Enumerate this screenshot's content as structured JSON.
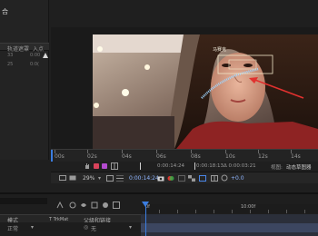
{
  "project_panel": {
    "title": "合",
    "columns": [
      "轨道遮罩",
      "入点"
    ],
    "rows": [
      {
        "a": "33",
        "b": "0:00"
      },
      {
        "a": "25",
        "b": "0:0("
      }
    ]
  },
  "viewer": {
    "mosaic_label": "马赛克",
    "colors": {
      "accent": "#e1312f",
      "track": "#9fd6ff"
    }
  },
  "time_ruler": {
    "labels": [
      "00s",
      "02s",
      "04s",
      "06s",
      "08s",
      "10s",
      "12s",
      "14s"
    ]
  },
  "info_row": {
    "start": "0:00:14:24",
    "end": "0:00:18:13",
    "duration": "Δ 0:00:03:21",
    "view_label": "视图:",
    "view_value": "动态草图器"
  },
  "viewer_toolbar": {
    "zoom": "29%",
    "timecode": "0:00:14:24",
    "exposure": "+0.0"
  },
  "timeline": {
    "ruler_label_start": "0f",
    "ruler_label_mid": "10:00f",
    "headers": {
      "mode": "模式",
      "t": "T TrkMat",
      "parent": "父级和链接"
    },
    "row": {
      "mode": "正常",
      "parent": "无"
    }
  }
}
